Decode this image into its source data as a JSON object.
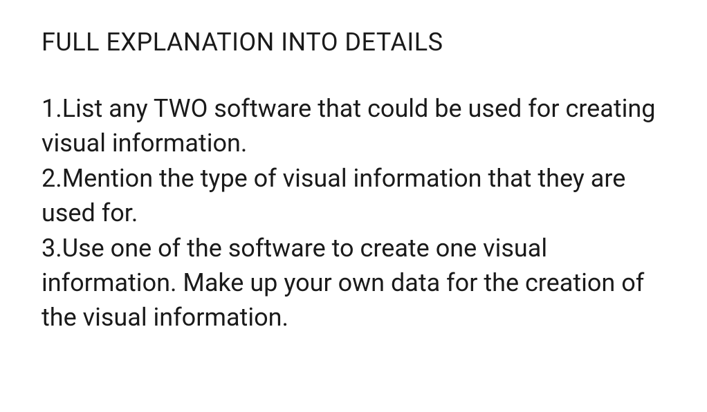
{
  "title": "FULL EXPLANATION INTO DETAILS",
  "items": [
    {
      "number": "1.",
      "text": "List any TWO software that could be used for creating visual information."
    },
    {
      "number": "2.",
      "text": "Mention the type of visual information that they are used for."
    },
    {
      "number": "3.",
      "text": "Use one of the software to create one visual information. Make up your own data for the creation of the visual information."
    }
  ]
}
